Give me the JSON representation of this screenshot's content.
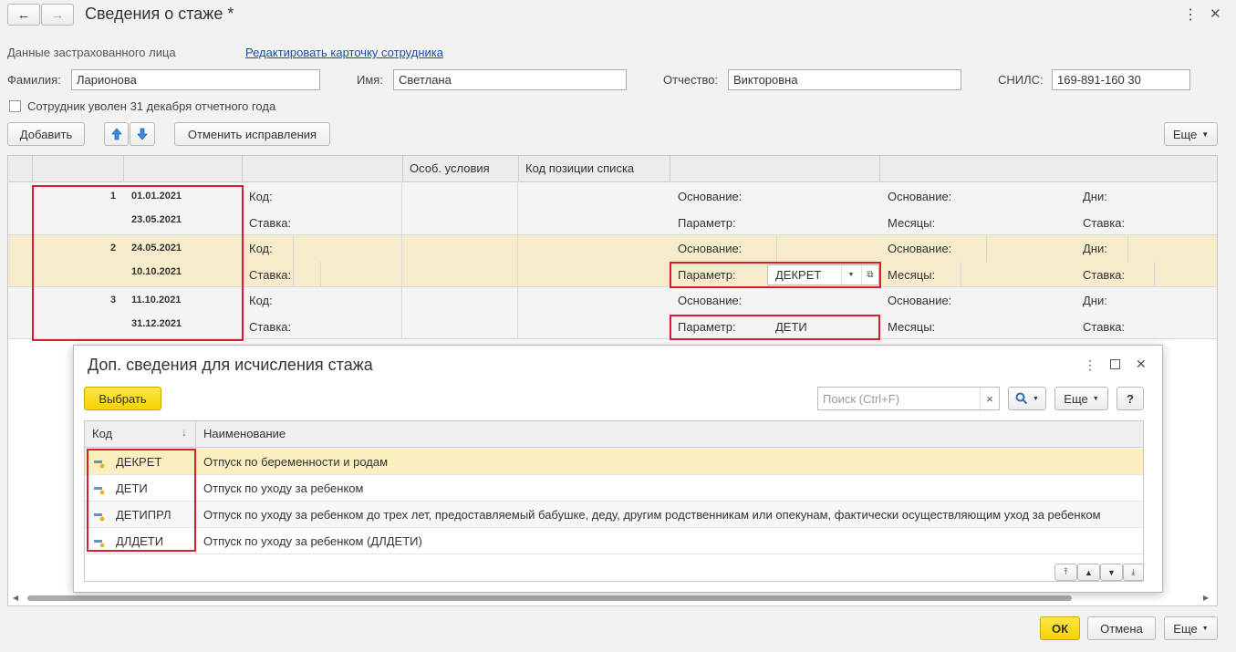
{
  "window": {
    "title": "Сведения о стаже *",
    "nav_back": "←",
    "nav_forward": "→",
    "more_icon": "⋮",
    "close_icon": "✕"
  },
  "insured": {
    "section_label": "Данные застрахованного лица",
    "edit_link": "Редактировать карточку сотрудника",
    "surname_label": "Фамилия:",
    "surname_value": "Ларионова",
    "name_label": "Имя:",
    "name_value": "Светлана",
    "patronymic_label": "Отчество:",
    "patronymic_value": "Викторовна",
    "snils_label": "СНИЛС:",
    "snils_value": "169-891-160 30",
    "dismissed_label": "Сотрудник уволен 31 декабря отчетного года"
  },
  "toolbar": {
    "add": "Добавить",
    "up_icon": "arrow-up-icon",
    "down_icon": "arrow-down-icon",
    "cancel_fixes": "Отменить исправления",
    "more": "Еще"
  },
  "grid": {
    "headers": [
      "Особ. условия",
      "Код позиции списка"
    ],
    "labels": {
      "kod": "Код:",
      "stavka": "Ставка:",
      "osnovanie": "Основание:",
      "parametr": "Параметр:",
      "mesyatsy": "Месяцы:",
      "dni": "Дни:"
    },
    "rows": [
      {
        "num": "1",
        "date_from": "01.01.2021",
        "date_to": "23.05.2021",
        "parametr_value": ""
      },
      {
        "num": "2",
        "date_from": "24.05.2021",
        "date_to": "10.10.2021",
        "parametr_value": "ДЕКРЕТ"
      },
      {
        "num": "3",
        "date_from": "11.10.2021",
        "date_to": "31.12.2021",
        "parametr_value": "ДЕТИ"
      }
    ]
  },
  "dialog": {
    "title": "Доп. сведения для исчисления стажа",
    "select_button": "Выбрать",
    "search_placeholder": "Поиск (Ctrl+F)",
    "clear_icon": "×",
    "more": "Еще",
    "help": "?",
    "col_code": "Код",
    "col_name": "Наименование",
    "items": [
      {
        "code": "ДЕКРЕТ",
        "name": "Отпуск по беременности и родам"
      },
      {
        "code": "ДЕТИ",
        "name": "Отпуск по уходу за ребенком"
      },
      {
        "code": "ДЕТИПРЛ",
        "name": "Отпуск по уходу за ребенком до трех лет, предоставляемый бабушке, деду, другим родственникам или опекунам, фактически осуществляющим уход за ребенком"
      },
      {
        "code": "ДЛДЕТИ",
        "name": "Отпуск по уходу за ребенком (ДЛДЕТИ)"
      }
    ]
  },
  "footer": {
    "ok": "ОК",
    "cancel": "Отмена",
    "more": "Еще"
  },
  "colors": {
    "selected_row": "#f6eccb",
    "dialog_selected_row": "#fbefc0",
    "highlight_border": "#d81e2a",
    "ok_button": "#f5d200"
  }
}
